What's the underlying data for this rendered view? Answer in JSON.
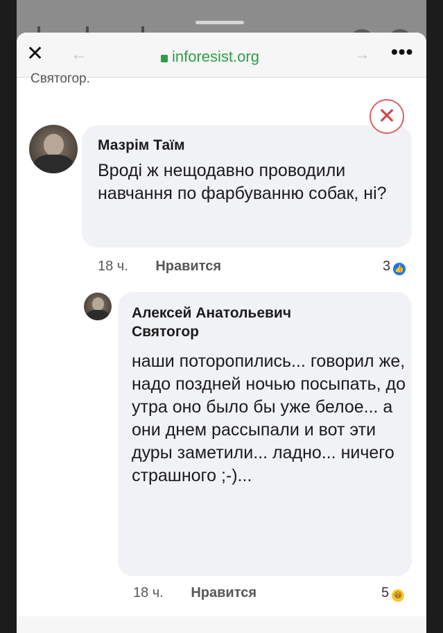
{
  "browser": {
    "close_label": "✕",
    "back_label": "←",
    "url": "inforesist.org",
    "forward_label": "→",
    "more_label": "•••"
  },
  "previous_author_cut": "Святогор.",
  "close_icon_glyph": "✕",
  "comments": [
    {
      "author": "Мазрім Таїм",
      "text": "Вроді ж нещодавно проводили навчання по фарбуванню собак, ні?",
      "time": "18 ч.",
      "like_label": "Нравится",
      "reaction_count": "3",
      "reaction_icon": "like-icon"
    },
    {
      "author": "Алексей Анатольевич Святогор",
      "text": "наши поторопились... говорил же, надо поздней ночью посыпать, до утра оно было бы уже белое... а они днем рассыпали и вот эти дуры заметили... ладно... ничего страшного ;-)...",
      "time": "18 ч.",
      "like_label": "Нравится",
      "reaction_count": "5",
      "reaction_icon": "haha-icon"
    }
  ],
  "colors": {
    "url_green": "#2e9e46",
    "bubble_bg": "#f0f2f5",
    "like_blue": "#1877f2",
    "haha_yellow": "#f7c534",
    "close_red": "#d14343"
  }
}
